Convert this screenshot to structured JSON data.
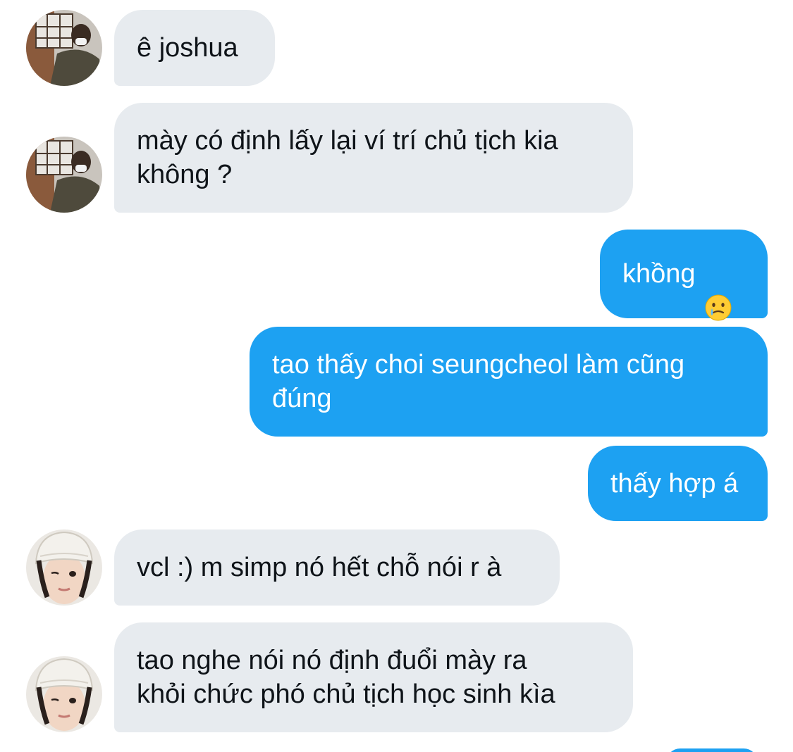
{
  "messages": [
    {
      "sender": "other",
      "avatar": "user-a-avatar",
      "text": "ê joshua"
    },
    {
      "sender": "other",
      "avatar": "user-a-avatar",
      "text": "mày có định lấy lại ví trí chủ tịch kia\nkhông ?"
    },
    {
      "sender": "me",
      "text": "khồng",
      "emoji": "crying-smile-emoji"
    },
    {
      "sender": "me",
      "text": "tao thấy choi seungcheol làm cũng\nđúng"
    },
    {
      "sender": "me",
      "text": "thấy hợp á"
    },
    {
      "sender": "other",
      "avatar": "user-b-avatar",
      "text": "vcl :) m simp nó hết chỗ nói r à"
    },
    {
      "sender": "other",
      "avatar": "user-b-avatar",
      "text": "tao nghe nói nó định đuổi mày ra\nkhỏi chức phó chủ tịch học sinh kìa"
    }
  ],
  "colors": {
    "incoming_bubble": "#e7ebef",
    "outgoing_bubble": "#1da1f2",
    "incoming_text": "#0f1419",
    "outgoing_text": "#ffffff"
  }
}
